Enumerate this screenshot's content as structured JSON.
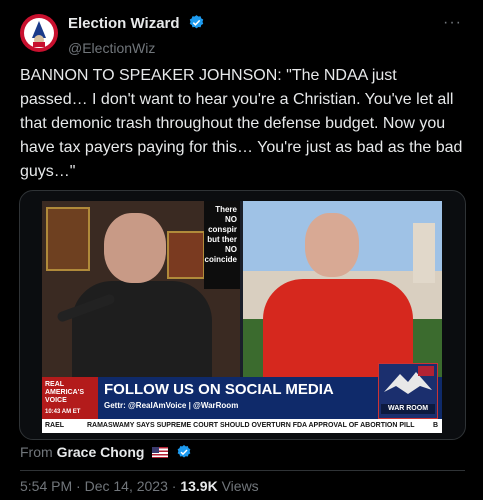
{
  "header": {
    "display_name": "Election Wizard",
    "handle": "@ElectionWiz",
    "more_label": "···"
  },
  "tweet": {
    "text": "BANNON TO SPEAKER JOHNSON: \"The NDAA just passed… I don't want to hear you're a Christian. You've let all that demonic trash throughout the defense budget. Now you have tax payers paying for this… You're just as bad as the bad guys…\""
  },
  "media": {
    "sign_text": "There NO conspir but ther NO coincide",
    "badge_line1": "REAL",
    "badge_line2": "AMERICA'S",
    "badge_line3": "VOICE",
    "badge_time": "10:43 AM ET",
    "follow_text": "FOLLOW US ON SOCIAL MEDIA",
    "social_handles": "Gettr: @RealAmVoice | @WarRoom",
    "logo_text": "WAR ROOM",
    "ticker_lead": "RAEL",
    "ticker_text": "RAMASWAMY SAYS SUPREME COURT SHOULD OVERTURN FDA APPROVAL OF ABORTION PILL",
    "ticker_end": "B"
  },
  "attribution": {
    "prefix": "From",
    "name": "Grace Chong"
  },
  "meta": {
    "time": "5:54 PM",
    "separator": "·",
    "date": "Dec 14, 2023",
    "views_count": "13.9K",
    "views_label": "Views"
  },
  "colors": {
    "background": "#000000",
    "text": "#e7e9ea",
    "muted": "#71767b",
    "verified": "#1d9bf0"
  }
}
